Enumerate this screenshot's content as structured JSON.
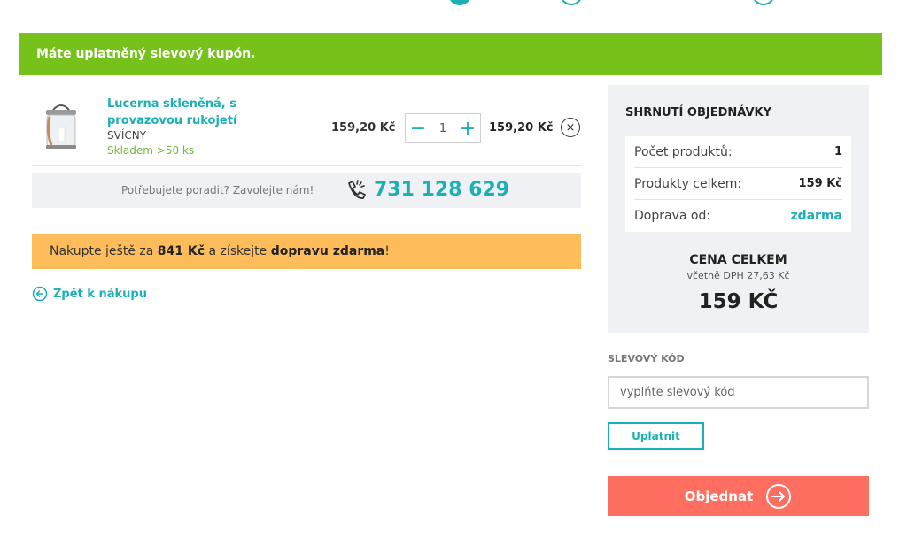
{
  "coupon_banner": {
    "text": "Máte uplatněný slevový kupón."
  },
  "product": {
    "name": "Lucerna skleněná, s provazovou rukojetí",
    "category": "SVÍCNY",
    "stock": "Skladem >50 ks",
    "unit_price": "159,20 Kč",
    "quantity": "1",
    "total_price": "159,20 Kč",
    "minus_glyph": "−",
    "plus_glyph": "+",
    "remove_glyph": "×"
  },
  "help": {
    "text": "Potřebujete poradit? Zavolejte nám!",
    "phone": "731 128 629"
  },
  "shipping": {
    "prefix": "Nakupte ještě za ",
    "amount": "841 Kč",
    "middle": " a získejte ",
    "highlight": "dopravu zdarma",
    "suffix": "!"
  },
  "back_link": {
    "label": "Zpět k nákupu"
  },
  "summary": {
    "title": "SHRNUTÍ OBJEDNÁVKY",
    "rows": [
      {
        "label": "Počet produktů:",
        "value": "1"
      },
      {
        "label": "Produkty celkem:",
        "value": "159 Kč"
      },
      {
        "label": "Doprava od:",
        "value": "zdarma"
      }
    ],
    "total_label": "CENA CELKEM",
    "vat_note": "včetně DPH 27,63 Kč",
    "total_amount": "159 KČ"
  },
  "discount": {
    "label": "SLEVOVÝ KÓD",
    "placeholder": "vyplňte slevový kód",
    "apply_label": "Uplatnit"
  },
  "order_button": {
    "label": "Objednat"
  },
  "colors": {
    "accent": "#1bb0b4",
    "banner_green": "#76c11a",
    "shipping_orange": "#ffbc5a",
    "order_red": "#ff6f61"
  }
}
